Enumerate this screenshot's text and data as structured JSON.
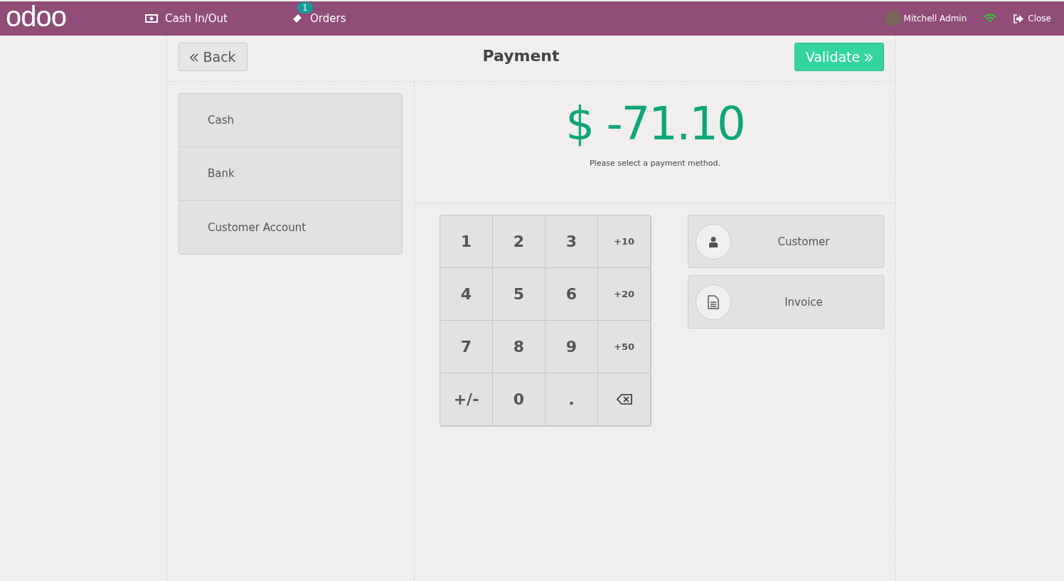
{
  "navbar": {
    "logo": "odoo",
    "items": [
      {
        "kind": "cash",
        "label": "Cash In/Out"
      },
      {
        "kind": "orders",
        "label": "Orders",
        "badge": "1"
      }
    ],
    "user": "Mitchell Admin",
    "close": "Close"
  },
  "header": {
    "back": "Back",
    "title": "Payment",
    "validate": "Validate"
  },
  "payment_methods": [
    "Cash",
    "Bank",
    "Customer Account"
  ],
  "amount": "$ -71.10",
  "hint": "Please select a payment method.",
  "numpad": [
    {
      "kind": "digit",
      "label": "1"
    },
    {
      "kind": "digit",
      "label": "2"
    },
    {
      "kind": "digit",
      "label": "3"
    },
    {
      "kind": "add",
      "label": "+10"
    },
    {
      "kind": "digit",
      "label": "4"
    },
    {
      "kind": "digit",
      "label": "5"
    },
    {
      "kind": "digit",
      "label": "6"
    },
    {
      "kind": "add",
      "label": "+20"
    },
    {
      "kind": "digit",
      "label": "7"
    },
    {
      "kind": "digit",
      "label": "8"
    },
    {
      "kind": "digit",
      "label": "9"
    },
    {
      "kind": "add",
      "label": "+50"
    },
    {
      "kind": "digit",
      "label": "+/-"
    },
    {
      "kind": "digit",
      "label": "0"
    },
    {
      "kind": "digit",
      "label": "."
    },
    {
      "kind": "backspace"
    }
  ],
  "actions": [
    {
      "kind": "customer",
      "label": "Customer"
    },
    {
      "kind": "invoice",
      "label": "Invoice"
    }
  ]
}
